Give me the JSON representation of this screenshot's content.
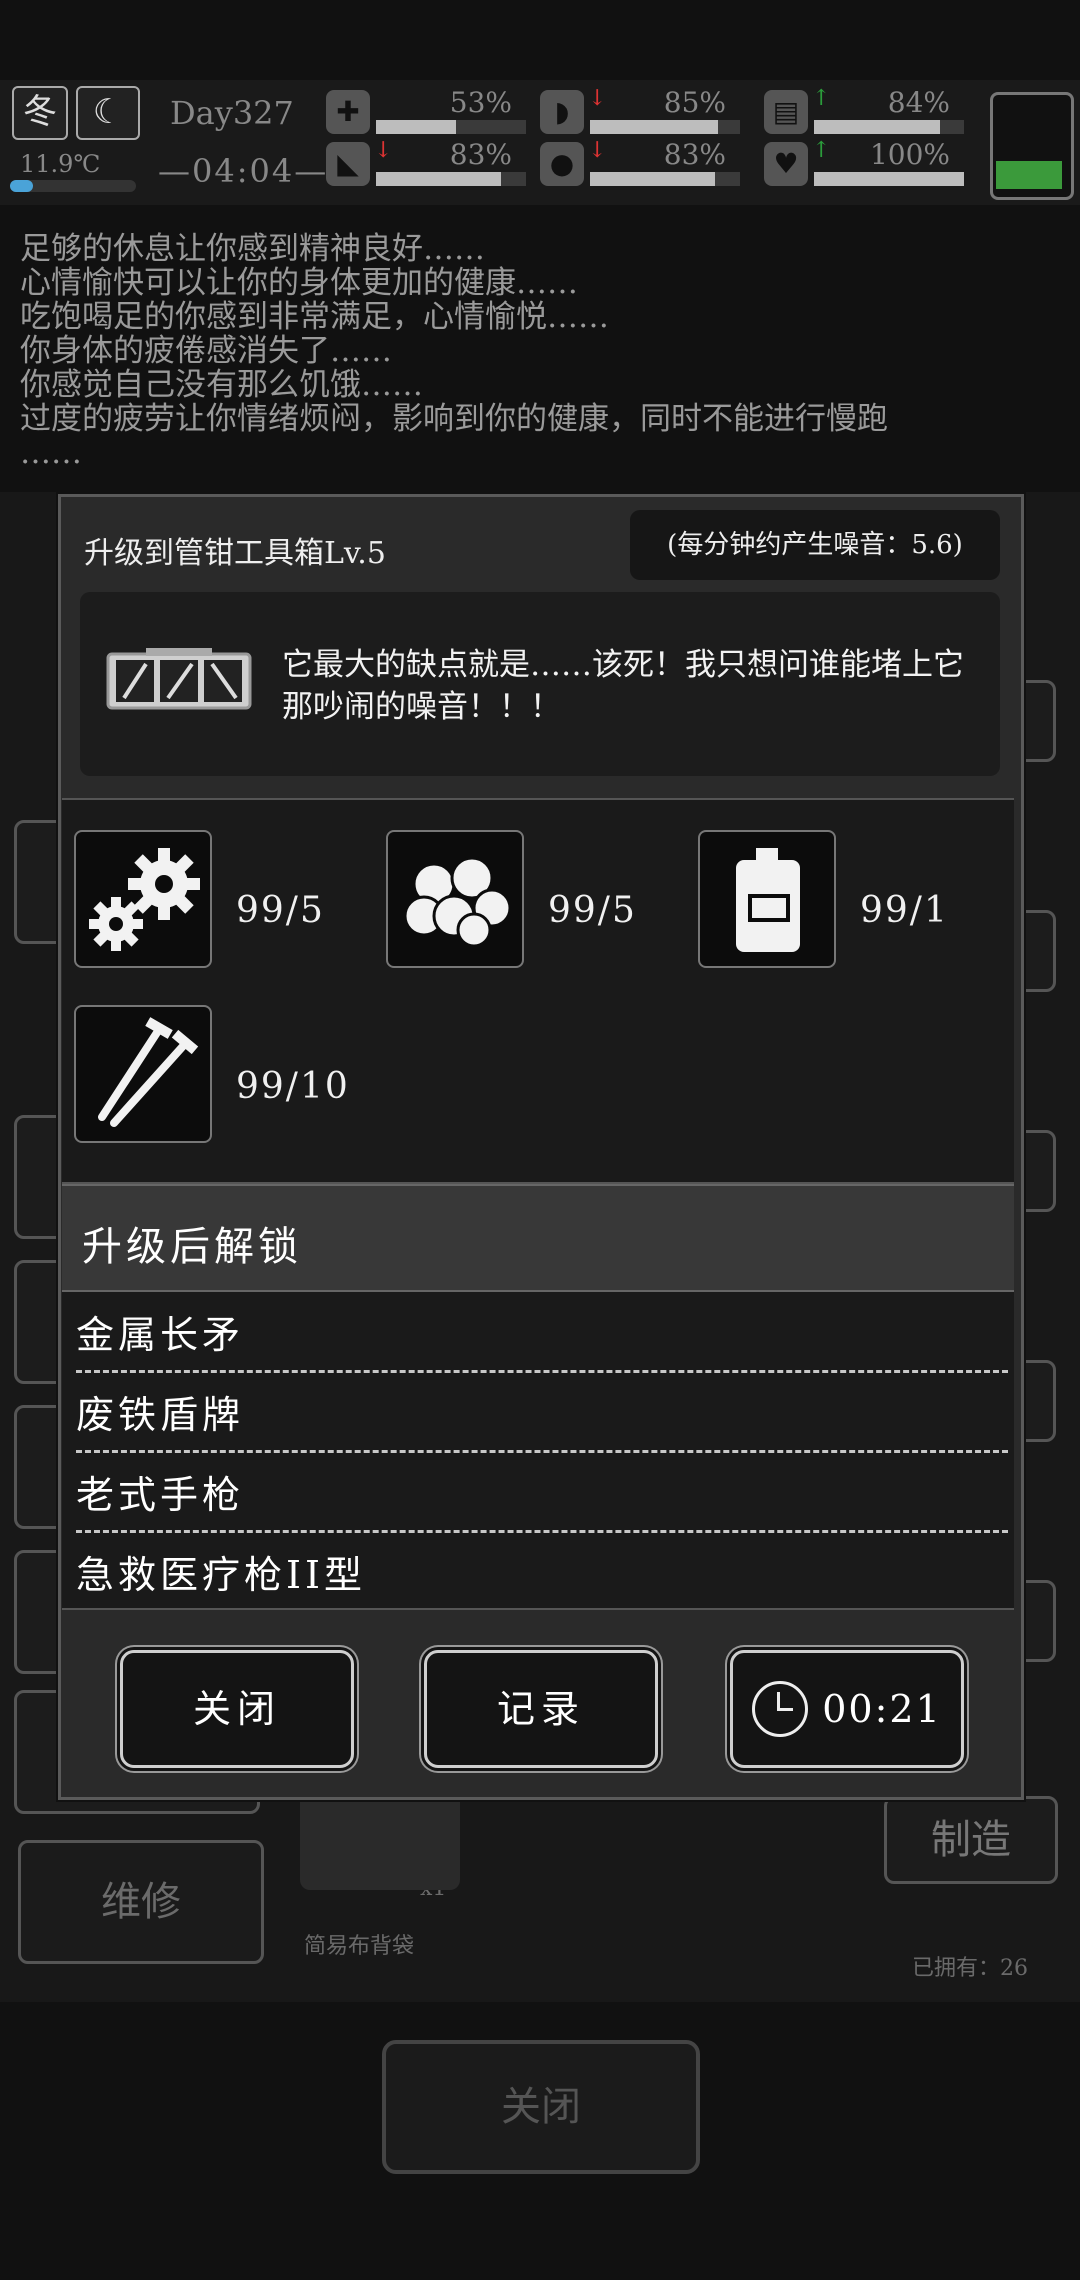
{
  "hud": {
    "season": "冬",
    "moon": "☾",
    "temperature": "11.9℃",
    "temperature_fill": 0.18,
    "day": "Day327",
    "time": "—04:04—",
    "stats": [
      {
        "icon": "medkit-icon",
        "pct": "53%",
        "fill": 0.53,
        "trend": "none"
      },
      {
        "icon": "stomach-icon",
        "pct": "85%",
        "fill": 0.85,
        "trend": "down"
      },
      {
        "icon": "bladder-icon",
        "pct": "84%",
        "fill": 0.84,
        "trend": "up"
      },
      {
        "icon": "leg-icon",
        "pct": "83%",
        "fill": 0.83,
        "trend": "down"
      },
      {
        "icon": "water-drop-icon",
        "pct": "83%",
        "fill": 0.83,
        "trend": "down"
      },
      {
        "icon": "heart-icon",
        "pct": "100%",
        "fill": 1.0,
        "trend": "up"
      }
    ],
    "battery_fill": 0.3,
    "battery_color": "#3b9a3b"
  },
  "log": [
    "足够的休息让你感到精神良好……",
    "心情愉快可以让你的身体更加的健康……",
    "吃饱喝足的你感到非常满足，心情愉悦……",
    "你身体的疲倦感消失了……",
    "你感觉自己没有那么饥饿……",
    "过度的疲劳让你情绪烦闷，影响到你的健康，同时不能进行慢跑",
    "……"
  ],
  "background": {
    "repair_label": "维修",
    "make_label": "制造",
    "small_item_name": "简易布背袋",
    "owned": "已拥有：26",
    "close_label": "关闭",
    "qty": "x1"
  },
  "dialog": {
    "title": "升级到管钳工具箱Lv.5",
    "noise": "(每分钟约产生噪音：5.6)",
    "description": "它最大的缺点就是……该死！我只想问谁能堵上它那吵闹的噪音！！！",
    "requirements": [
      {
        "icon": "gears-icon",
        "count": "99/5"
      },
      {
        "icon": "cotton-balls-icon",
        "count": "99/5"
      },
      {
        "icon": "fuel-canister-icon",
        "count": "99/1"
      },
      {
        "icon": "screws-icon",
        "count": "99/10"
      }
    ],
    "unlock_title": "升级后解锁",
    "unlocks": [
      "金属长矛",
      "废铁盾牌",
      "老式手枪",
      "急救医疗枪II型"
    ],
    "buttons": {
      "close": "关闭",
      "record": "记录",
      "timer": "00:21"
    }
  }
}
